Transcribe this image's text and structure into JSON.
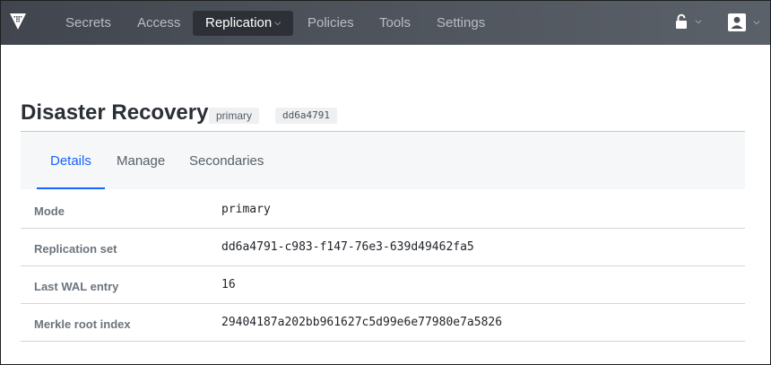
{
  "nav": {
    "items": [
      {
        "label": "Secrets"
      },
      {
        "label": "Access"
      },
      {
        "label": "Replication",
        "active": true
      },
      {
        "label": "Policies"
      },
      {
        "label": "Tools"
      },
      {
        "label": "Settings"
      }
    ],
    "utilities": [
      "lock-open-icon",
      "user-icon"
    ]
  },
  "page": {
    "title": "Disaster Recovery",
    "tags": [
      "primary",
      "dd6a4791"
    ]
  },
  "tabs": [
    {
      "label": "Details",
      "active": true
    },
    {
      "label": "Manage"
    },
    {
      "label": "Secondaries"
    }
  ],
  "details": [
    {
      "label": "Mode",
      "value": "primary"
    },
    {
      "label": "Replication set",
      "value": "dd6a4791-c983-f147-76e3-639d49462fa5"
    },
    {
      "label": "Last WAL entry",
      "value": "16"
    },
    {
      "label": "Merkle root index",
      "value": "29404187a202bb961627c5d99e6e77980e7a5826"
    }
  ],
  "colors": {
    "nav_bg": "#4a4f57",
    "active_nav_bg": "#2d3137",
    "accent": "#1563ff"
  }
}
